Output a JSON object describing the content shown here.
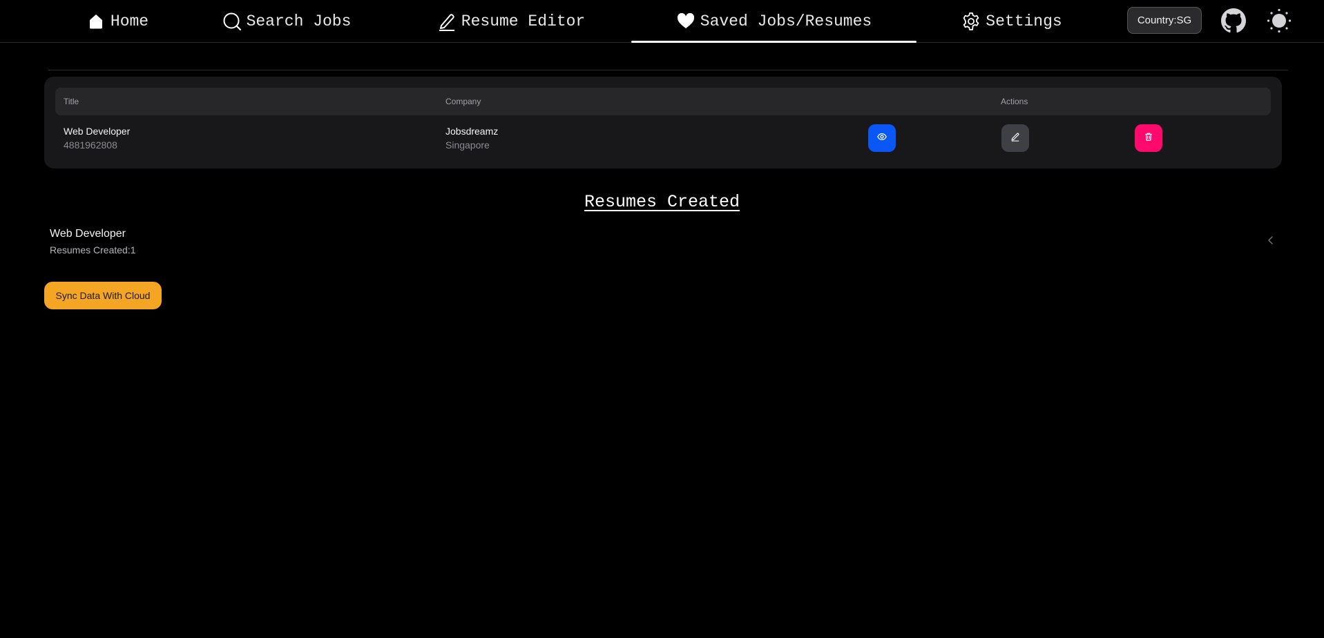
{
  "nav": {
    "items": [
      {
        "label": "Home",
        "icon": "home-icon"
      },
      {
        "label": "Search Jobs",
        "icon": "search-icon"
      },
      {
        "label": "Resume Editor",
        "icon": "pencil-icon"
      },
      {
        "label": "Saved Jobs/Resumes",
        "icon": "heart-icon",
        "active": true
      },
      {
        "label": "Settings",
        "icon": "gear-icon"
      }
    ],
    "country_label": "Country:SG",
    "github_icon": "github-icon",
    "theme_icon": "sun-icon"
  },
  "saved_jobs": {
    "columns": [
      "Title",
      "Company",
      "Actions"
    ],
    "rows": [
      {
        "title": "Web Developer",
        "job_id": "4881962808",
        "company": "Jobsdreamz",
        "location": "Singapore",
        "actions": [
          "eye-icon",
          "pencil-icon",
          "trash-icon"
        ]
      }
    ]
  },
  "resumes": {
    "heading": "Resumes Created",
    "items": [
      {
        "title": "Web Developer",
        "count_label": "Resumes Created:1"
      }
    ]
  },
  "sync_button_label": "Sync Data With Cloud",
  "colors": {
    "background": "#000000",
    "view_button": "#0b57f5",
    "edit_button": "#3f3f46",
    "delete_button": "#ff0a6c",
    "sync_button": "#f5a524"
  }
}
